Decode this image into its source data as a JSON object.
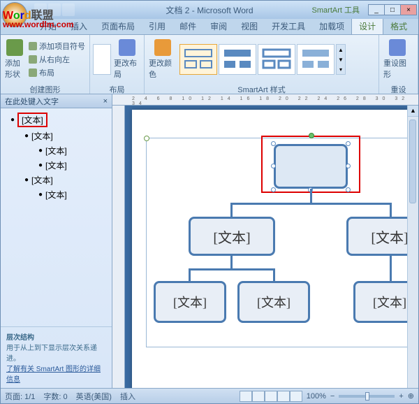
{
  "title": "文档 2 - Microsoft Word",
  "context_tab_title": "SmartArt 工具",
  "watermark_text": "联盟",
  "watermark_url": "www.wordlm.com",
  "tabs": [
    "开始",
    "插入",
    "页面布局",
    "引用",
    "邮件",
    "审阅",
    "视图",
    "开发工具",
    "加载项"
  ],
  "context_tabs": {
    "design": "设计",
    "format": "格式"
  },
  "win_controls": {
    "min": "_",
    "max": "□",
    "close": "×"
  },
  "ribbon": {
    "add_shape": "添加形状",
    "create_graphic": {
      "add_bullet": "添加项目符号",
      "rtl": "从右向左",
      "layout": "布局",
      "label": "创建图形"
    },
    "layout_group": {
      "change_layout": "更改布局",
      "label": "布局"
    },
    "color_group": {
      "change_color": "更改颜色"
    },
    "styles_label": "SmartArt 样式",
    "reset": {
      "btn": "重设图形",
      "label": "重设"
    }
  },
  "text_pane": {
    "header": "在此处键入文字",
    "close": "×",
    "items": [
      {
        "level": 0,
        "text": "[文本]",
        "highlight": true
      },
      {
        "level": 1,
        "text": "[文本]"
      },
      {
        "level": 2,
        "text": "[文本]"
      },
      {
        "level": 2,
        "text": "[文本]"
      },
      {
        "level": 1,
        "text": "[文本]"
      },
      {
        "level": 2,
        "text": "[文本]"
      }
    ],
    "footer_title": "层次结构",
    "footer_desc": "用于从上到下显示层次关系递进。",
    "footer_link": "了解有关 SmartArt 图形的详细信息"
  },
  "node_text": "[文本]",
  "status": {
    "page": "页面: 1/1",
    "words": "字数: 0",
    "lang": "英语(美国)",
    "mode": "插入",
    "zoom": "100%",
    "minus": "−",
    "plus": "+",
    "expand": "⊕"
  }
}
